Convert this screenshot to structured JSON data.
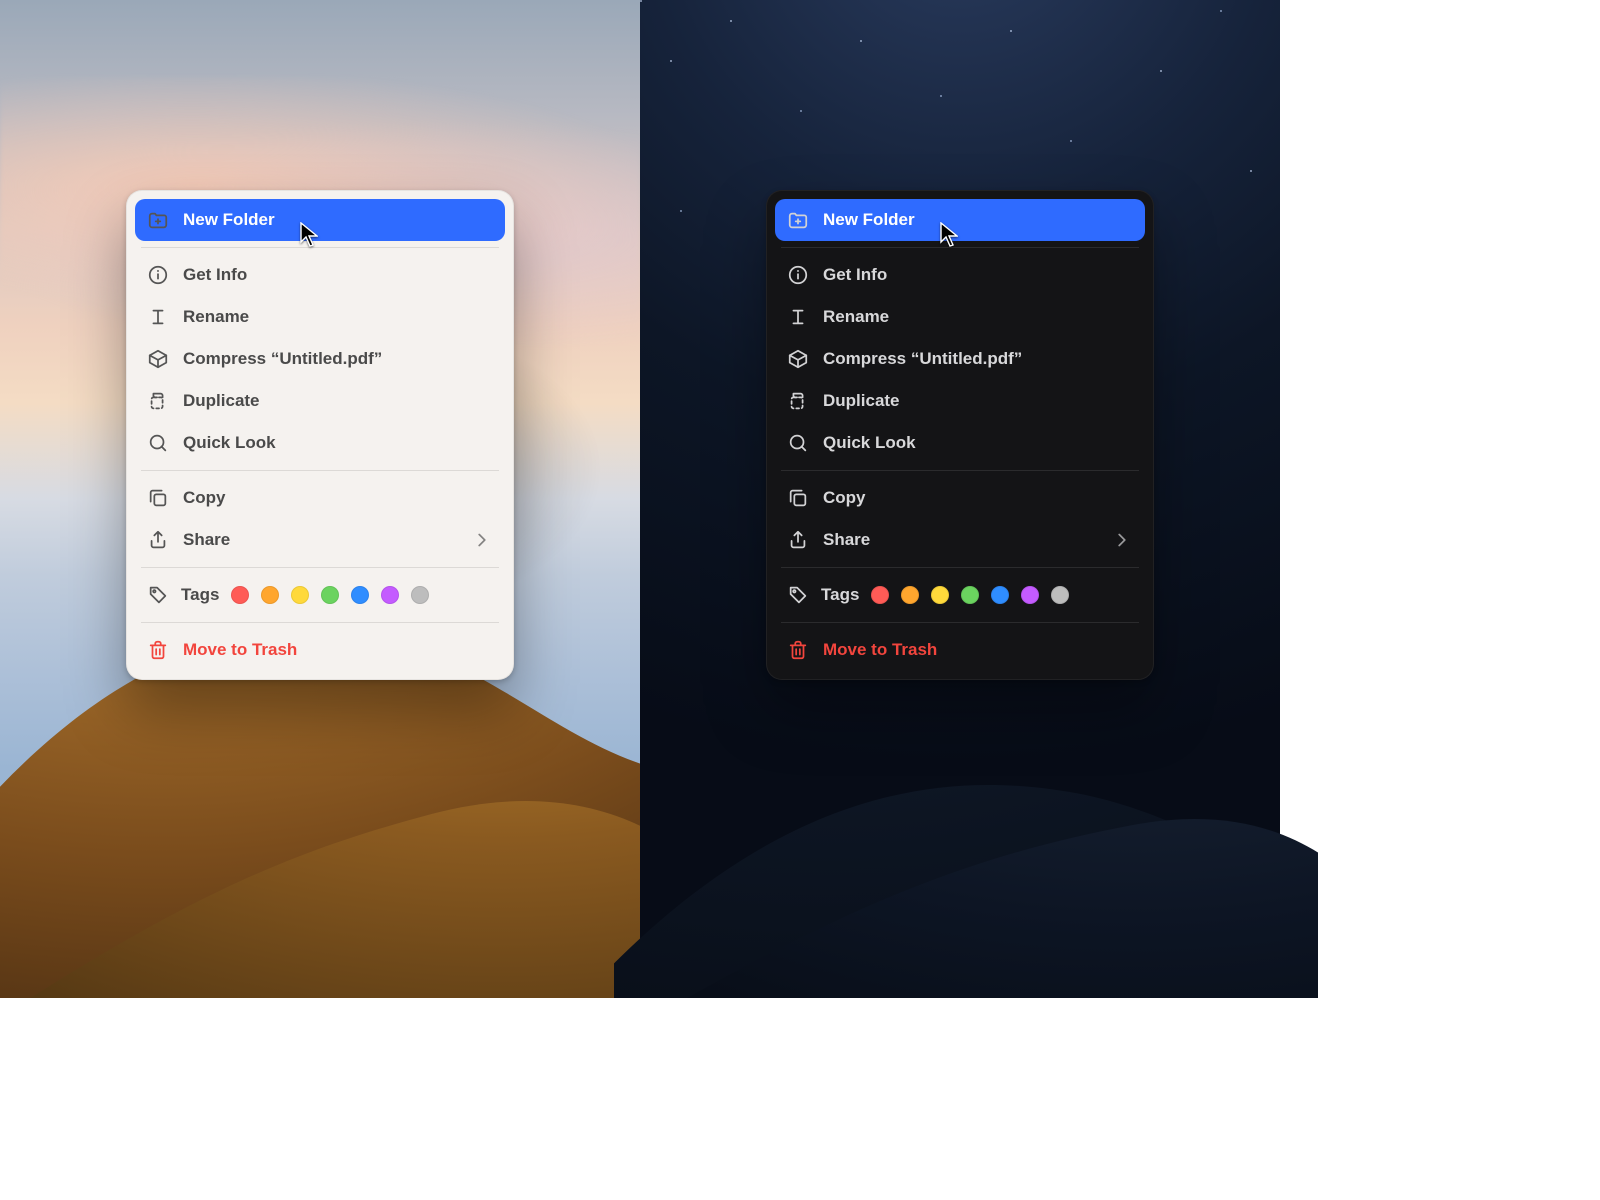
{
  "accent": "#2f6bff",
  "menu": {
    "new_folder": "New Folder",
    "get_info": "Get Info",
    "rename": "Rename",
    "compress": "Compress “Untitled.pdf”",
    "duplicate": "Duplicate",
    "quick_look": "Quick Look",
    "copy": "Copy",
    "share": "Share",
    "tags_label": "Tags",
    "trash": "Move to Trash"
  },
  "tag_colors": [
    "#ff5b56",
    "#ffa62e",
    "#ffd93b",
    "#6bd35f",
    "#2f8dff",
    "#c45bff",
    "#bdbdbd"
  ]
}
